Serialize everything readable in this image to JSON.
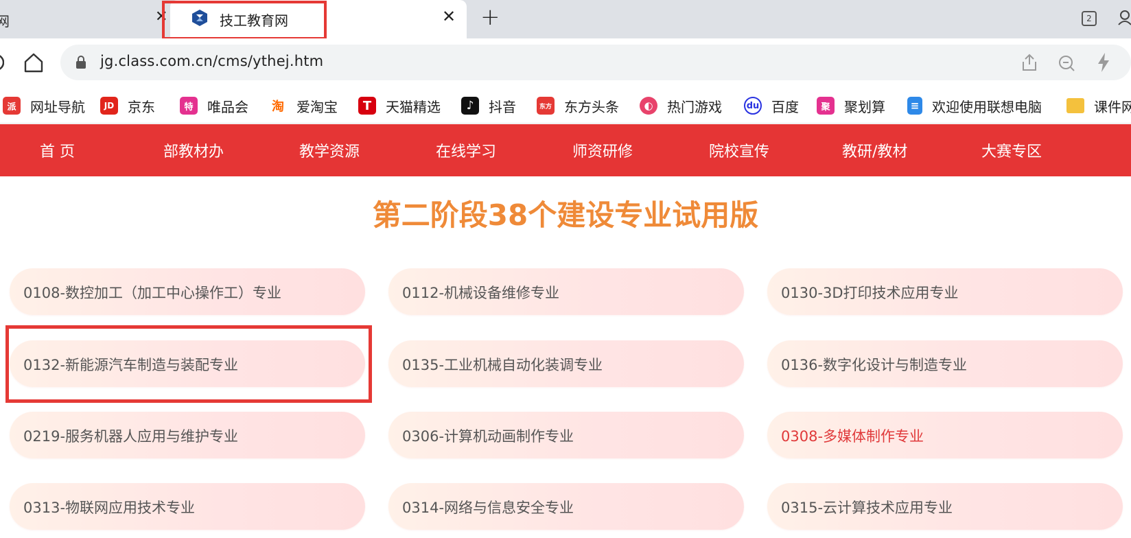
{
  "browser": {
    "prev_tab_title": "网",
    "prev_tab_close": "✕",
    "active_tab_title": "技工教育网",
    "active_tab_close": "✕",
    "new_tab": "+",
    "tab_count": "2",
    "url": "jg.class.com.cn/cms/ythej.htm"
  },
  "bookmarks": [
    {
      "label": "网址导航",
      "icon": "wangzhi-daohang-icon",
      "glyph": "派",
      "color": "#e53935"
    },
    {
      "label": "京东",
      "icon": "jd-icon",
      "glyph": "JD",
      "color": "#e1251b"
    },
    {
      "label": "唯品会",
      "icon": "vip-icon",
      "glyph": "特",
      "color": "#e4318f"
    },
    {
      "label": "爱淘宝",
      "icon": "taobao-icon",
      "glyph": "淘",
      "color": "#ff6a00"
    },
    {
      "label": "天猫精选",
      "icon": "tmall-icon",
      "glyph": "T",
      "color": "#d7000f"
    },
    {
      "label": "抖音",
      "icon": "douyin-icon",
      "glyph": "♪",
      "color": "#111111"
    },
    {
      "label": "东方头条",
      "icon": "dongfang-icon",
      "glyph": "东方",
      "color": "#e53935"
    },
    {
      "label": "热门游戏",
      "icon": "game-icon",
      "glyph": "◐",
      "color": "#e8436b"
    },
    {
      "label": "百度",
      "icon": "baidu-paw-icon",
      "glyph": "du",
      "color": "#2932e1"
    },
    {
      "label": "聚划算",
      "icon": "juhuasuan-icon",
      "glyph": "聚",
      "color": "#e4318f"
    },
    {
      "label": "欢迎使用联想电脑",
      "icon": "document-icon",
      "glyph": "≡",
      "color": "#2e89e8"
    },
    {
      "label": "课件网",
      "icon": "folder-icon",
      "glyph": "",
      "color": "#f4c13d"
    }
  ],
  "site_nav": [
    "首 页",
    "部教材办",
    "教学资源",
    "在线学习",
    "师资研修",
    "院校宣传",
    "教研/教材",
    "大赛专区"
  ],
  "heading": "第二阶段38个建设专业试用版",
  "majors": [
    "0108-数控加工（加工中心操作工）专业",
    "0112-机械设备维修专业",
    "0130-3D打印技术应用专业",
    "0132-新能源汽车制造与装配专业",
    "0135-工业机械自动化装调专业",
    "0136-数字化设计与制造专业",
    "0219-服务机器人应用与维护专业",
    "0306-计算机动画制作专业",
    "0308-多媒体制作专业",
    "0313-物联网应用技术专业",
    "0314-网络与信息安全专业",
    "0315-云计算技术应用专业"
  ],
  "active_major": "0308-多媒体制作专业",
  "colors": {
    "nav_red": "#e53535",
    "heading_orange": "#ef8a38",
    "highlight_red": "#e53935",
    "active_text": "#e0393a"
  }
}
